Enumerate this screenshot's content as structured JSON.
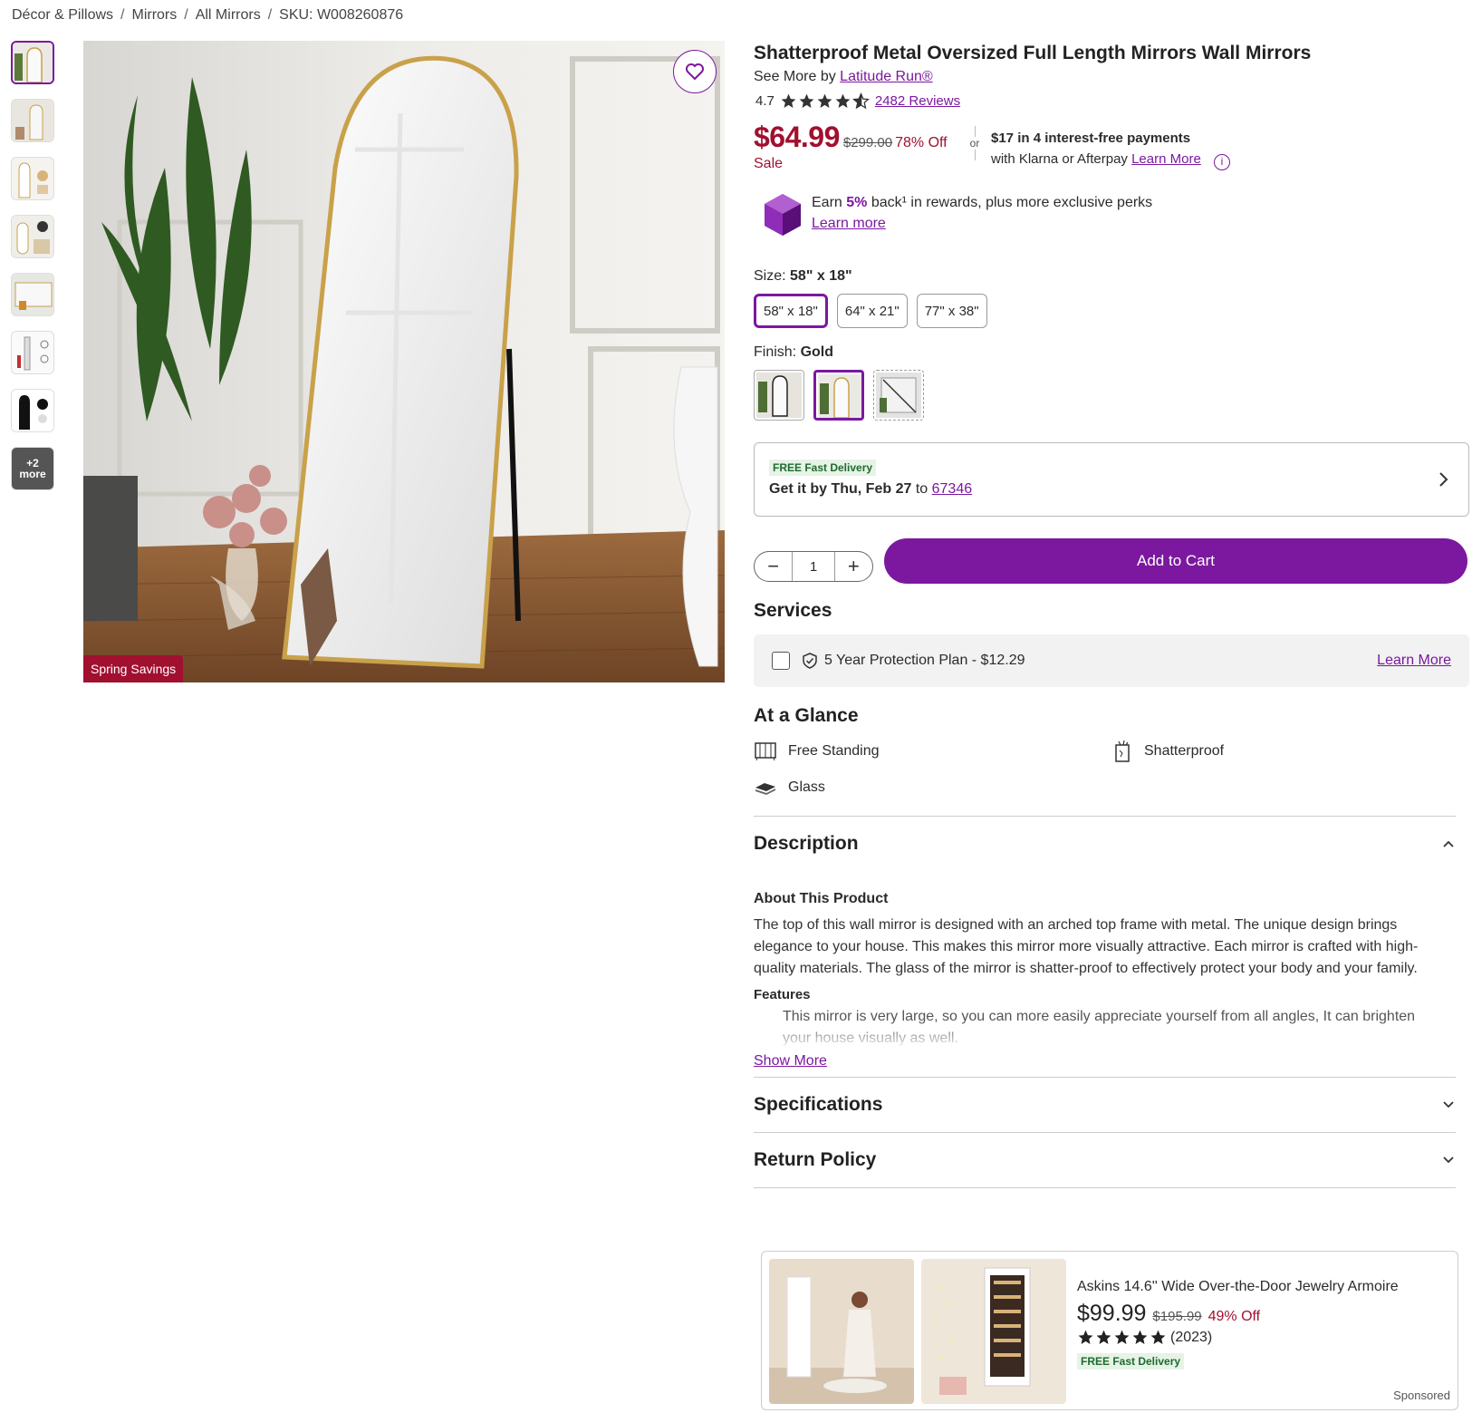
{
  "breadcrumb": [
    "Décor & Pillows",
    "Mirrors",
    "All Mirrors",
    "SKU: W008260876"
  ],
  "gallery": {
    "more_count": "+2",
    "more_label": "more",
    "badge": "Spring Savings"
  },
  "product": {
    "title": "Shatterproof Metal Oversized Full Length Mirrors Wall Mirrors",
    "see_more_prefix": "See More by",
    "brand": "Latitude Run®",
    "rating": "4.7",
    "reviews": "2482 Reviews",
    "price": "$64.99",
    "was_price": "$299.00",
    "discount": "78% Off",
    "sale_label": "Sale",
    "or": "or",
    "installment": "$17 in 4 interest-free payments",
    "installment_providers": "with Klarna or Afterpay",
    "learn_more": "Learn More"
  },
  "rewards": {
    "earn": "Earn",
    "pct": "5%",
    "rest": "back¹ in rewards, plus more exclusive perks",
    "link": "Learn more"
  },
  "size": {
    "label": "Size:",
    "selected": "58\" x 18\"",
    "options": [
      "58\" x 18\"",
      "64\" x 21\"",
      "77\" x 38\""
    ]
  },
  "finish": {
    "label": "Finish:",
    "selected": "Gold"
  },
  "delivery": {
    "tag": "FREE Fast Delivery",
    "prefix": "Get it by",
    "date": "Thu, Feb 27",
    "to": "to",
    "zip": "67346"
  },
  "cart": {
    "qty": "1",
    "minus": "−",
    "plus": "+",
    "add_label": "Add to Cart"
  },
  "services": {
    "heading": "Services",
    "plan": "5 Year Protection Plan - $12.29",
    "link": "Learn More"
  },
  "glance": {
    "heading": "At a Glance",
    "items": [
      "Free Standing",
      "Shatterproof",
      "Glass"
    ]
  },
  "description": {
    "heading": "Description",
    "about_heading": "About This Product",
    "about_text": "The top of this wall mirror is designed with an arched top frame with metal. The unique design brings elegance to your house. This makes this mirror more visually attractive. Each mirror is crafted with high-quality materials. The glass of the mirror is shatter-proof to effectively protect your body and your family.",
    "features_heading": "Features",
    "feature_1": "This mirror is very large, so you can more easily appreciate yourself from all angles, It can brighten your house visually as well.",
    "show_more": "Show More"
  },
  "specifications": {
    "heading": "Specifications"
  },
  "return_policy": {
    "heading": "Return Policy"
  },
  "sponsored": {
    "title": "Askins 14.6'' Wide Over-the-Door Jewelry Armoire",
    "price": "$99.99",
    "was_price": "$195.99",
    "discount": "49% Off",
    "reviews": "(2023)",
    "tag": "FREE Fast Delivery",
    "label": "Sponsored"
  },
  "colors": {
    "accent": "#7b189f",
    "sale": "#a1102f"
  }
}
